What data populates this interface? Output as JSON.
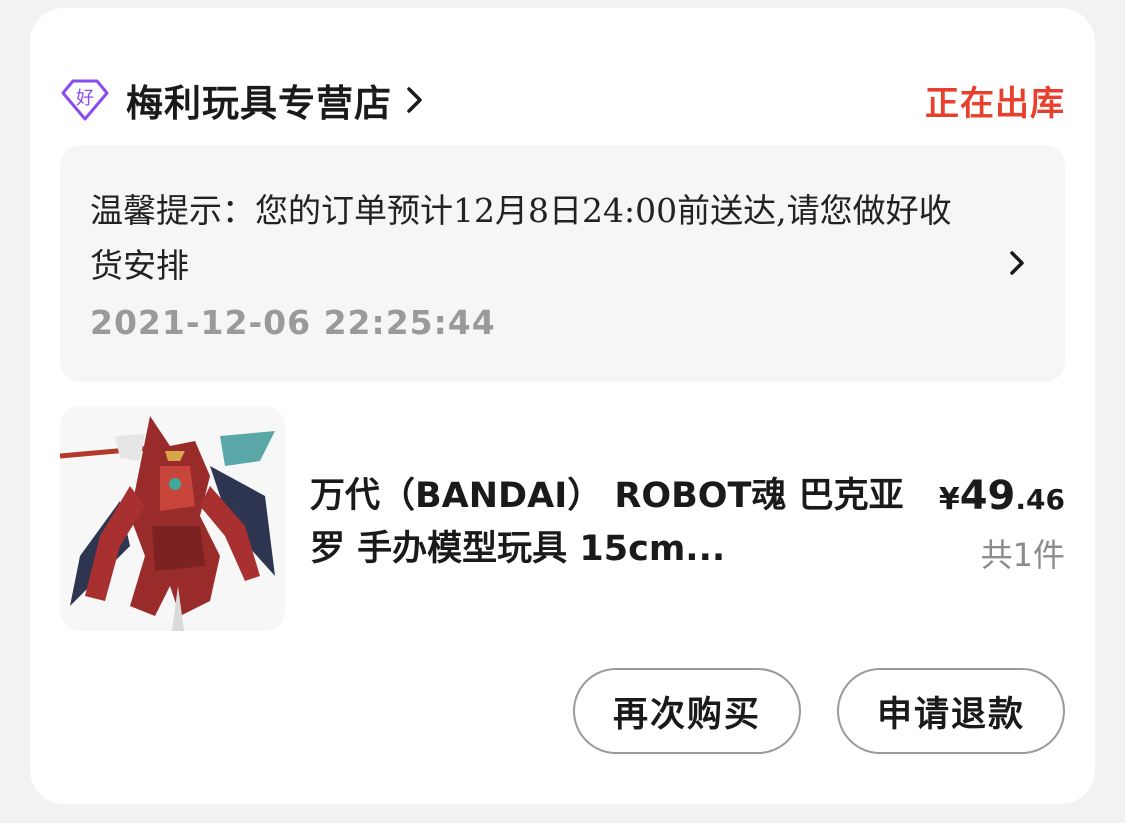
{
  "shop": {
    "badge_text": "好",
    "name": "梅利玩具专营店",
    "order_status": "正在出库",
    "colors": {
      "badge": "#8a4cf0",
      "status": "#e8402c"
    }
  },
  "tip": {
    "message": "温馨提示：您的订单预计12月8日24:00前送达,请您做好收货安排",
    "timestamp": "2021-12-06 22:25:44"
  },
  "product": {
    "title": "万代（BANDAI） ROBOT魂 巴克亚罗 手办模型玩具 15cm...",
    "price_symbol": "¥",
    "price_int": "49",
    "price_dec": ".46",
    "quantity": "共1件",
    "image_icon": "robot-figure-thumbnail"
  },
  "actions": {
    "rebuy_label": "再次购买",
    "refund_label": "申请退款"
  }
}
